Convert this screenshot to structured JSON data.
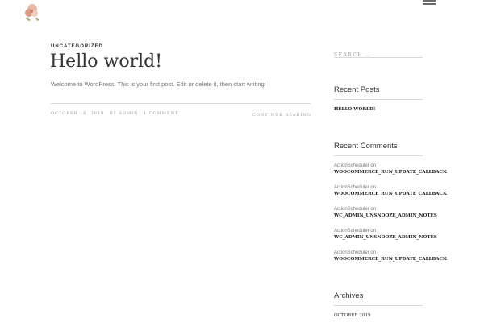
{
  "header": {
    "logo_icon": "floral-logo-icon",
    "menu_icon": "hamburger-menu-icon"
  },
  "post": {
    "category": "UNCATEGORIZED",
    "title": "Hello world!",
    "excerpt": "Welcome to WordPress. This is your first post. Edit or delete it, then start writing!",
    "date": "OCTOBER 16, 2019",
    "by_label": "BY",
    "author": "ADMIN",
    "comments": "1 COMMENT",
    "continue_label": "CONTINUE READING"
  },
  "sidebar": {
    "search": {
      "placeholder": "SEARCH …"
    },
    "recent_posts": {
      "title": "Recent Posts",
      "items": [
        "HELLO WORLD!"
      ]
    },
    "recent_comments": {
      "title": "Recent Comments",
      "items": [
        {
          "author": "ActionScheduler",
          "on_label": "on",
          "post": "WOOCOMMERCE_RUN_UPDATE_CALLBACK"
        },
        {
          "author": "ActionScheduler",
          "on_label": "on",
          "post": "WOOCOMMERCE_RUN_UPDATE_CALLBACK"
        },
        {
          "author": "ActionScheduler",
          "on_label": "on",
          "post": "WC_ADMIN_UNSNOOZE_ADMIN_NOTES"
        },
        {
          "author": "ActionScheduler",
          "on_label": "on",
          "post": "WC_ADMIN_UNSNOOZE_ADMIN_NOTES"
        },
        {
          "author": "ActionScheduler",
          "on_label": "on",
          "post": "WOOCOMMERCE_RUN_UPDATE_CALLBACK"
        }
      ]
    },
    "archives": {
      "title": "Archives",
      "items": [
        "OCTOBER 2019"
      ]
    }
  }
}
